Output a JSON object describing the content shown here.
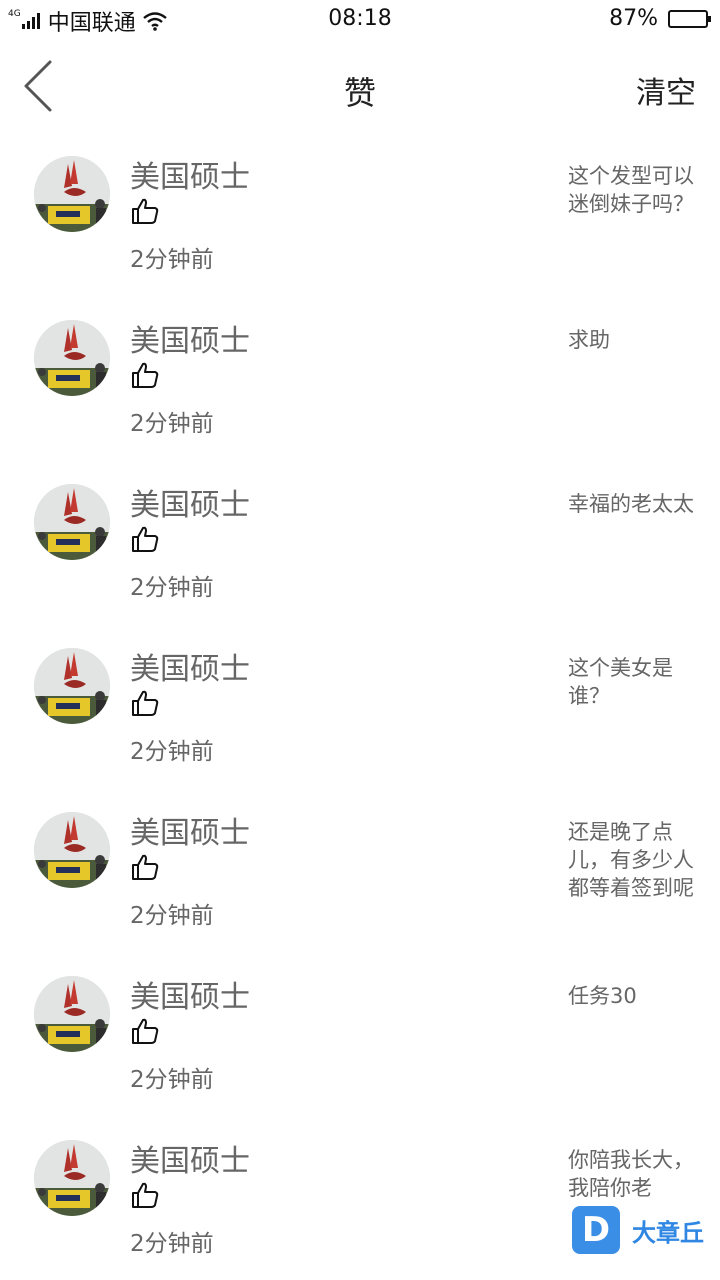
{
  "status_bar": {
    "network": "4G",
    "carrier": "中国联通",
    "time": "08:18",
    "battery": "87%",
    "battery_level": 0.87
  },
  "nav": {
    "title": "赞",
    "clear_label": "清空"
  },
  "items": [
    {
      "name": "美国硕士",
      "time": "2分钟前",
      "post": "这个发型可以迷倒妹子吗？"
    },
    {
      "name": "美国硕士",
      "time": "2分钟前",
      "post": "求助"
    },
    {
      "name": "美国硕士",
      "time": "2分钟前",
      "post": "幸福的老太太"
    },
    {
      "name": "美国硕士",
      "time": "2分钟前",
      "post": "这个美女是谁？"
    },
    {
      "name": "美国硕士",
      "time": "2分钟前",
      "post": "还是晚了点儿，有多少人都等着签到呢"
    },
    {
      "name": "美国硕士",
      "time": "2分钟前",
      "post": "任务30"
    },
    {
      "name": "美国硕士",
      "time": "2分钟前",
      "post": "你陪我长大，我陪你老"
    }
  ],
  "watermark": {
    "logo": "D",
    "text": "大章丘"
  }
}
